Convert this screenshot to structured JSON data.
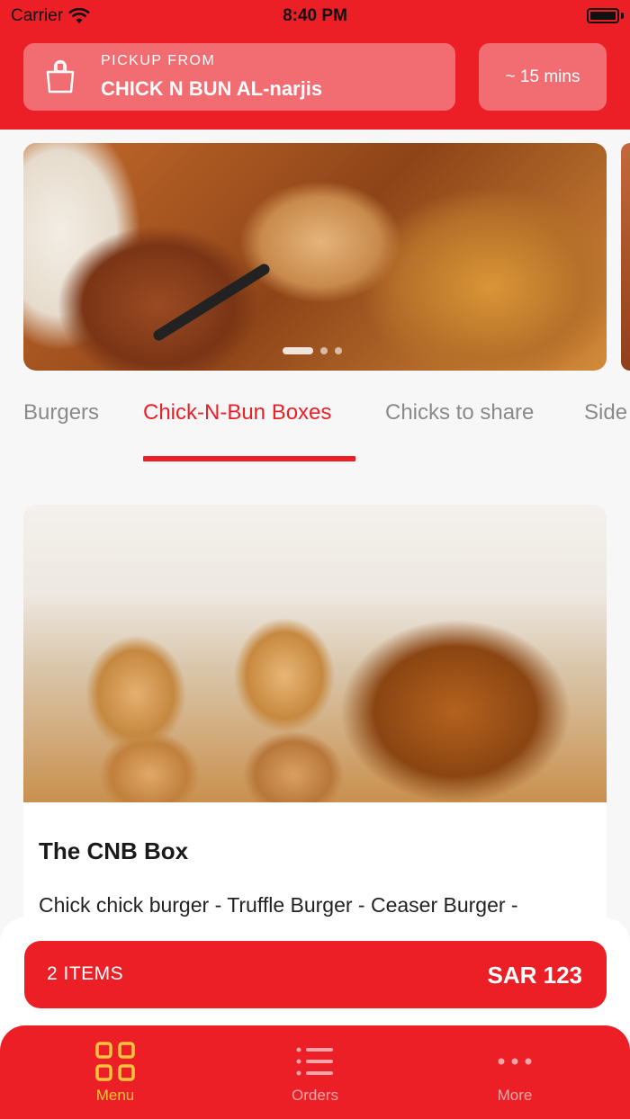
{
  "status_bar": {
    "carrier": "Carrier",
    "time": "8:40 PM"
  },
  "header": {
    "pickup_label": "PICKUP FROM",
    "pickup_name": "CHICK N BUN AL-narjis",
    "eta": "~ 15 mins"
  },
  "carousel": {
    "total_slides": 3,
    "active_slide": 1
  },
  "tabs": [
    {
      "label": "Burgers",
      "active": false
    },
    {
      "label": "Chick-N-Bun Boxes",
      "active": true
    },
    {
      "label": "Chicks to share",
      "active": false
    },
    {
      "label": "Side",
      "active": false
    }
  ],
  "product": {
    "name": "The CNB Box",
    "description": "Chick chick burger - Truffle Burger - Ceaser Burger -"
  },
  "cart": {
    "items_label": "2 ITEMS",
    "total": "SAR 123"
  },
  "nav": [
    {
      "label": "Menu",
      "icon": "grid-icon",
      "active": true
    },
    {
      "label": "Orders",
      "icon": "list-icon",
      "active": false
    },
    {
      "label": "More",
      "icon": "more-dots-icon",
      "active": false
    }
  ],
  "colors": {
    "brand": "#ec1f27",
    "active_nav": "#f6c33f"
  }
}
